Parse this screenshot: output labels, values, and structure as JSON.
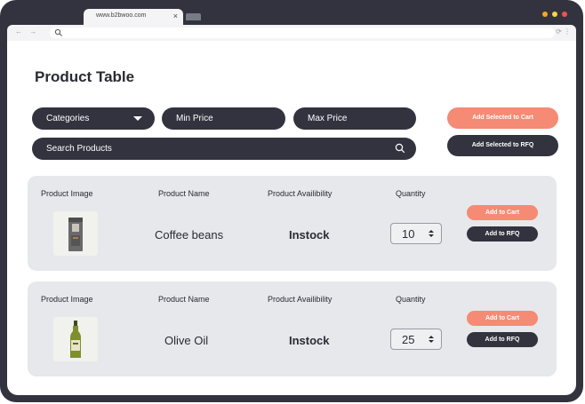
{
  "browser": {
    "tab_url": "www.b2bwoo.com",
    "tab_close": "×",
    "nav_arrows": "← →",
    "chrome_icons": "⟳ ⋮",
    "window_dot_colors": [
      "#f5a623",
      "#f8d24b",
      "#ef5350"
    ]
  },
  "page": {
    "title": "Product Table",
    "filters": {
      "categories": "Categories",
      "min_price": "Min Price",
      "max_price": "Max Price",
      "search_placeholder": "Search Products"
    },
    "actions": {
      "add_selected_cart": "Add Selected to Cart",
      "add_selected_rfq": "Add Selected to RFQ"
    },
    "columns": {
      "image": "Product Image",
      "name": "Product Name",
      "availability": "Product Availibility",
      "quantity": "Quantity"
    },
    "products": [
      {
        "name": "Coffee beans",
        "availability": "Instock",
        "quantity": "10",
        "add_cart": "Add to Cart",
        "add_rfq": "Add to RFQ",
        "image_icon": "coffee-bag-icon"
      },
      {
        "name": "Olive Oil",
        "availability": "Instock",
        "quantity": "25",
        "add_cart": "Add to Cart",
        "add_rfq": "Add to RFQ",
        "image_icon": "olive-oil-bottle-icon"
      }
    ]
  },
  "colors": {
    "frame": "#33333f",
    "accent_coral": "#f58a75",
    "card_bg": "#e6e8eb"
  }
}
